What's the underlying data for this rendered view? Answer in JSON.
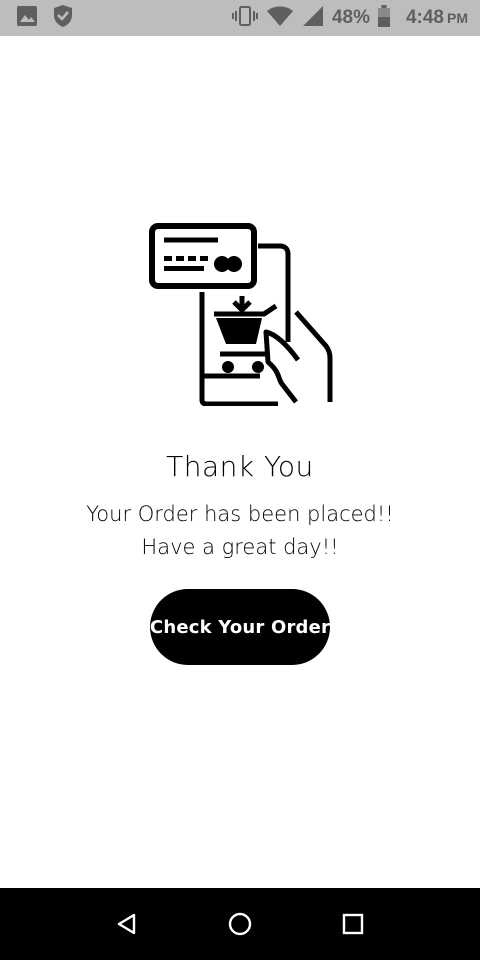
{
  "status_bar": {
    "battery_percent": "48%",
    "time": "4:48",
    "ampm": "PM",
    "icons": [
      "image-icon",
      "shield-icon",
      "vibrate-icon",
      "wifi-icon",
      "signal-icon",
      "battery-icon"
    ]
  },
  "confirmation": {
    "title": "Thank You",
    "message_line1": "Your Order has been placed!!",
    "message_line2": "Have a great day!!",
    "button_label": "Check Your Order"
  },
  "nav_bar": {
    "icons": [
      "back-icon",
      "home-icon",
      "recents-icon"
    ]
  },
  "colors": {
    "status_bar_bg": "#bdbdbd",
    "status_icon": "#5f5f5f",
    "accent": "#000000",
    "background": "#ffffff"
  }
}
